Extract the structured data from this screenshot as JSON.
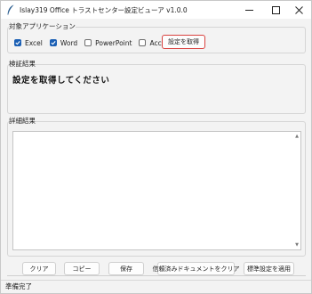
{
  "window": {
    "title": "Islay319 Office トラストセンター設定ビューア v1.0.0",
    "minimize_icon": "minimize-icon",
    "maximize_icon": "maximize-icon",
    "close_icon": "close-icon"
  },
  "target_apps": {
    "group_label": "対象アプリケーション",
    "checkboxes": [
      {
        "label": "Excel",
        "checked": true
      },
      {
        "label": "Word",
        "checked": true
      },
      {
        "label": "PowerPoint",
        "checked": false
      },
      {
        "label": "Access",
        "checked": false
      }
    ],
    "get_settings_button": "設定を取得"
  },
  "verification": {
    "group_label": "検証結果",
    "message": "設定を取得してください"
  },
  "details": {
    "group_label": "詳細結果",
    "content": ""
  },
  "buttons": {
    "clear": "クリア",
    "copy": "コピー",
    "save": "保存",
    "clear_trusted_docs": "信頼済みドキュメントをクリア",
    "apply_standard": "標準設定を適用"
  },
  "status": {
    "text": "準備完了"
  },
  "colors": {
    "accent": "#1a5fb4",
    "highlight_border": "#d9423f"
  }
}
